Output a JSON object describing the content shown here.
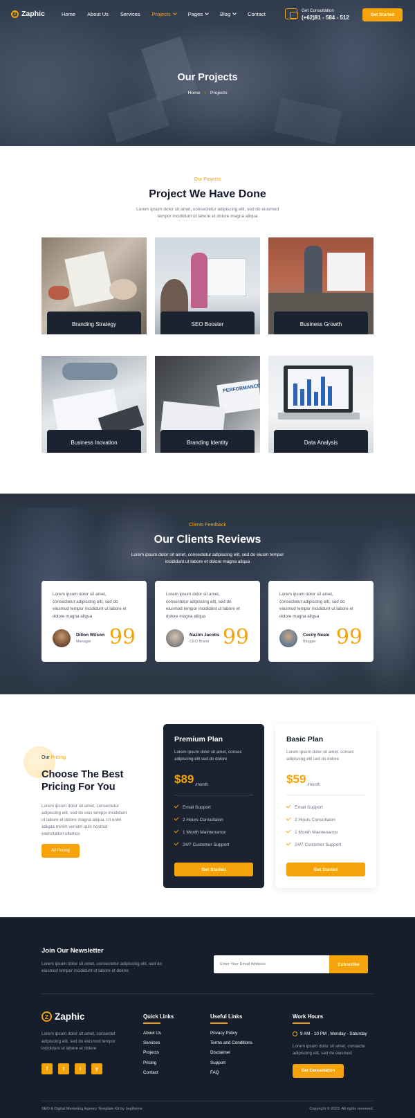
{
  "header": {
    "brand": "Zaphic",
    "nav": [
      "Home",
      "About Us",
      "Services",
      "Projects",
      "Pages",
      "Blog",
      "Contact"
    ],
    "active_nav": "Projects",
    "consult_label": "Get Consultation",
    "consult_phone": "(+62)81 - 584 - 512",
    "cta": "Get Started"
  },
  "hero": {
    "title": "Our Projects",
    "breadcrumb": [
      "Home",
      "Projects"
    ]
  },
  "projects": {
    "kicker": "Our Projects",
    "title": "Project We Have Done",
    "lead_line1": "Lorem ipsum dolor sit amet, consectetur adipiscing elit, sed do eiusmod",
    "lead_line2": "tempor incididunt ut labore et dolore magna aliqua",
    "items": [
      {
        "label": "Branding Strategy"
      },
      {
        "label": "SEO Booster"
      },
      {
        "label": "Business Growth"
      },
      {
        "label": "Business Inovation"
      },
      {
        "label": "Branding Identity"
      },
      {
        "label": "Data Analysis"
      }
    ],
    "image_text": "PERFORMANCE"
  },
  "reviews": {
    "kicker": "Clients Feedback",
    "title": "Our Clients Reviews",
    "lead_line1": "Lorem ipsum dolor sit amet, consectetur adipiscing elit, sed do eiusm tempor",
    "lead_line2": "incididunt ut labore et dolore magna aliqua",
    "cards": [
      {
        "text": [
          "Lorem ipsum dolor sit amet,",
          "consectetur adipiscing elit, sed do",
          "eiusmod tempor incididunt ut labore et",
          "dolore magna aliqua"
        ],
        "name": "Dillon Wilson",
        "role": "Manager"
      },
      {
        "text": [
          "Lorem ipsum dolor sit amet,",
          "consectetur adipiscing elit, sed do",
          "eiusmod tempor incididunt ut labore et",
          "dolore magna aliqua"
        ],
        "name": "Nazim Jacobs",
        "role": "CEO Brand"
      },
      {
        "text": [
          "Lorem ipsum dolor sit amet,",
          "consectetur adipiscing elit, sed do",
          "eiusmod tempor incididunt ut labore et",
          "dolore magna aliqua"
        ],
        "name": "Cecily Neale",
        "role": "Blogger"
      }
    ]
  },
  "pricing": {
    "kicker_a": "Our",
    "kicker_b": "Pricing",
    "title_line1": "Choose The Best",
    "title_line2": "Pricing For You",
    "text": [
      "Lorem ipsum dolor sit amet, consectetur",
      "adipiscing elit, sed do eius tempor incididunt",
      "ut labore et dolore magna aliqua. Ut enim",
      "adiqua minim veniam quis nostrud",
      "exercitation ullamco"
    ],
    "button": "All Pricing",
    "plans": [
      {
        "name": "Premium Plan",
        "desc": [
          "Lorem ipsum dolor sit amet, consec",
          "adipiscing elit sed do dolore"
        ],
        "price": "$89",
        "period": "/month",
        "features": [
          "Email Support",
          "2 Hours Consultaion",
          "1 Month Maintenance",
          "24/7 Customer Support"
        ],
        "button": "Get Started"
      },
      {
        "name": "Basic Plan",
        "desc": [
          "Lorem ipsum dolor sit amet, consec",
          "adipiscing elit sed do dolore"
        ],
        "price": "$59",
        "period": "/month",
        "features": [
          "Email Support",
          "2 Hours Consultaion",
          "1 Month Maintenance",
          "24/7 Customer Support"
        ],
        "button": "Get Started"
      }
    ]
  },
  "footer": {
    "newsletter_title": "Join Our Newsletter",
    "newsletter_text1": "Lorem ipsum dolor sit amet, consectetur adipiscing elit, sed do",
    "newsletter_text2": "eiusmod tempor incididunt ut labore et dolore",
    "email_placeholder": "Enter Your Email Address",
    "subscribe": "Subscribe",
    "brand": "Zaphic",
    "about": [
      "Lorem ipsum dolor sit amet, consectet",
      "adipiscing elit, sed do eiusmod tempor",
      "incididunt ut labore et dolore"
    ],
    "social": [
      "f",
      "t",
      "i",
      "y"
    ],
    "quick_links_title": "Quick Links",
    "quick_links": [
      "About Us",
      "Services",
      "Projects",
      "Pricing",
      "Contact"
    ],
    "useful_links_title": "Useful Links",
    "useful_links": [
      "Privacy Policy",
      "Terms and Conditions",
      "Disclaimer",
      "Support",
      "FAQ"
    ],
    "hours_title": "Work Hours",
    "hours": "9 AM - 10 PM , Monday - Saturday",
    "hours_text1": "Lorem ipsum dolor sit amet, consecte",
    "hours_text2": "adipiscing elit, sed do eiusmod",
    "hours_button": "Get Consultation",
    "copyright_left": "SEO & Digital Marketing Agency Template Kit by Jegtheme",
    "copyright_right": "Copyright © 2023. All rights reserved."
  },
  "colors": {
    "accent": "#f5a30a",
    "dark": "#161e2b",
    "card_dark": "#1b2331"
  }
}
